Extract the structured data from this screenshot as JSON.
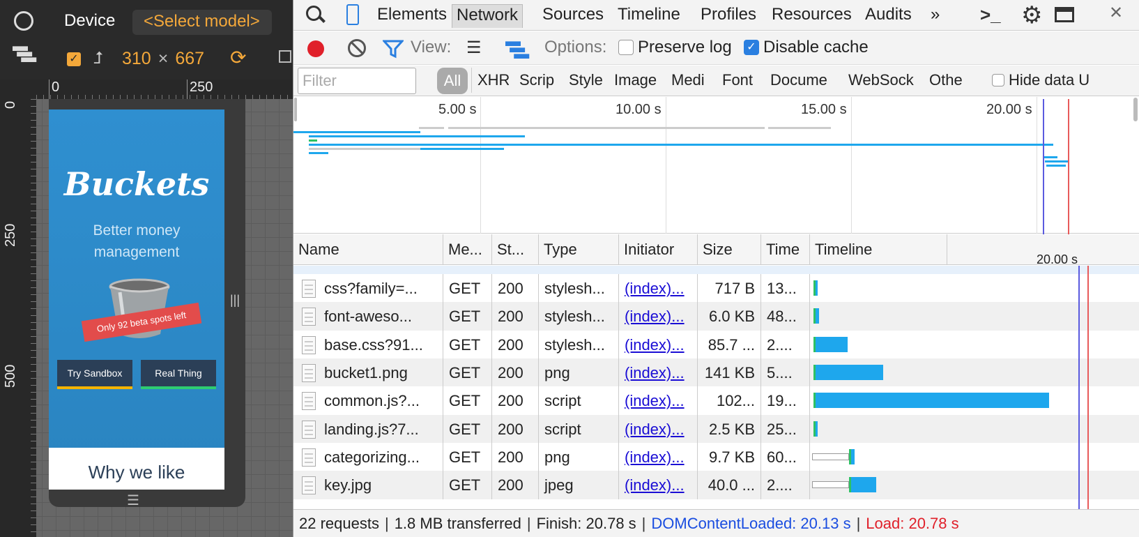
{
  "device": {
    "title": "Device",
    "model": "<Select model>",
    "width": "310",
    "times": "×",
    "height": "667",
    "ruler_h": [
      "0",
      "250"
    ],
    "ruler_v": [
      "0",
      "250",
      "500"
    ]
  },
  "mobile_page": {
    "brand": "Buckets",
    "tagline_1": "Better money",
    "tagline_2": "management",
    "banner": "Only 92 beta spots left",
    "btn_sandbox": "Try Sandbox",
    "btn_real": "Real Thing",
    "why": "Why we like"
  },
  "tabs": [
    "Elements",
    "Network",
    "Sources",
    "Timeline",
    "Profiles",
    "Resources",
    "Audits"
  ],
  "more_tabs": "»",
  "toolbar": {
    "view_label": "View:",
    "options_label": "Options:",
    "preserve_log": "Preserve log",
    "disable_cache": "Disable cache"
  },
  "filter_bar": {
    "placeholder": "Filter",
    "all": "All",
    "types": [
      "XHR",
      "Scrip",
      "Style",
      "Image",
      "Medi",
      "Font",
      "Docume",
      "WebSock",
      "Othe"
    ],
    "hide_data": "Hide data U"
  },
  "overview": {
    "ticks": [
      "5.00 s",
      "10.00 s",
      "15.00 s",
      "20.00 s"
    ]
  },
  "columns": [
    "Name",
    "Me...",
    "St...",
    "Type",
    "Initiator",
    "Size",
    "Time",
    "Timeline"
  ],
  "timeline_tick": "20.00 s",
  "rows": [
    {
      "name": "css?family=...",
      "method": "GET",
      "status": "200",
      "type": "stylesh...",
      "initiator": "(index)...",
      "size": "717 B",
      "time": "13...",
      "wait": 0,
      "bar_start": 0.005,
      "bar_end": 0.025
    },
    {
      "name": "font-aweso...",
      "method": "GET",
      "status": "200",
      "type": "stylesh...",
      "initiator": "(index)...",
      "size": "6.0 KB",
      "time": "48...",
      "wait": 0,
      "bar_start": 0.005,
      "bar_end": 0.03
    },
    {
      "name": "base.css?91...",
      "method": "GET",
      "status": "200",
      "type": "stylesh...",
      "initiator": "(index)...",
      "size": "85.7 ...",
      "time": "2....",
      "wait": 0,
      "bar_start": 0.005,
      "bar_end": 0.15
    },
    {
      "name": "bucket1.png",
      "method": "GET",
      "status": "200",
      "type": "png",
      "initiator": "(index)...",
      "size": "141 KB",
      "time": "5....",
      "wait": 0,
      "bar_start": 0.005,
      "bar_end": 0.3
    },
    {
      "name": "common.js?...",
      "method": "GET",
      "status": "200",
      "type": "script",
      "initiator": "(index)...",
      "size": "102...",
      "time": "19...",
      "wait": 0,
      "bar_start": 0.005,
      "bar_end": 1.0
    },
    {
      "name": "landing.js?7...",
      "method": "GET",
      "status": "200",
      "type": "script",
      "initiator": "(index)...",
      "size": "2.5 KB",
      "time": "25...",
      "wait": 0,
      "bar_start": 0.005,
      "bar_end": 0.025
    },
    {
      "name": "categorizing...",
      "method": "GET",
      "status": "200",
      "type": "png",
      "initiator": "(index)...",
      "size": "9.7 KB",
      "time": "60...",
      "wait": 1,
      "bar_start": 0.155,
      "bar_end": 0.18
    },
    {
      "name": "key.jpg",
      "method": "GET",
      "status": "200",
      "type": "jpeg",
      "initiator": "(index)...",
      "size": "40.0 ...",
      "time": "2....",
      "wait": 1,
      "bar_start": 0.155,
      "bar_end": 0.27
    }
  ],
  "status_bar": {
    "requests": "22 requests",
    "transferred": "1.8 MB transferred",
    "finish": "Finish: 20.78 s",
    "dcl": "DOMContentLoaded: 20.13 s",
    "load": "Load: 20.78 s"
  },
  "colors": {
    "accent": "#f4a83a",
    "record": "#e0202a",
    "bar": "#1ea7ed",
    "dcl": "#1a4de0",
    "load": "#e0202a"
  }
}
